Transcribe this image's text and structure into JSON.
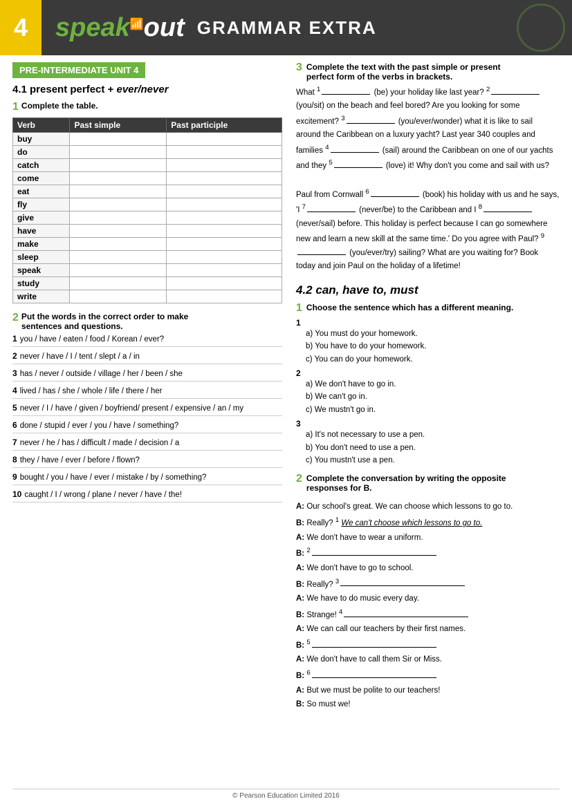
{
  "header": {
    "number": "4",
    "logo_speak": "speak",
    "logo_out": "out",
    "subtitle": "GRAMMAR EXTRA"
  },
  "unit_badge": "PRE-INTERMEDIATE UNIT 4",
  "section_4_1": {
    "title": "4.1 present perfect + ",
    "title_italic": "ever/never",
    "exercise1": {
      "label": "Complete the table.",
      "table": {
        "headers": [
          "Verb",
          "Past simple",
          "Past participle"
        ],
        "rows": [
          [
            "buy",
            "",
            ""
          ],
          [
            "do",
            "",
            ""
          ],
          [
            "catch",
            "",
            ""
          ],
          [
            "come",
            "",
            ""
          ],
          [
            "eat",
            "",
            ""
          ],
          [
            "fly",
            "",
            ""
          ],
          [
            "give",
            "",
            ""
          ],
          [
            "have",
            "",
            ""
          ],
          [
            "make",
            "",
            ""
          ],
          [
            "sleep",
            "",
            ""
          ],
          [
            "speak",
            "",
            ""
          ],
          [
            "study",
            "",
            ""
          ],
          [
            "write",
            "",
            ""
          ]
        ]
      }
    },
    "exercise2": {
      "intro": "Put the words in the correct order to make sentences and questions.",
      "items": [
        {
          "num": "1",
          "text": "you / have / eaten / food / Korean / ever?"
        },
        {
          "num": "2",
          "text": "never / have / I / tent / slept / a / in"
        },
        {
          "num": "3",
          "text": "has / never / outside / village / her / been / she"
        },
        {
          "num": "4",
          "text": "lived / has / she / whole / life / there / her"
        },
        {
          "num": "5",
          "text": "never / I / have / given / boyfriend/ present / expensive / an / my"
        },
        {
          "num": "6",
          "text": "done / stupid / ever / you / have / something?"
        },
        {
          "num": "7",
          "text": "never / he / has / difficult / made / decision / a"
        },
        {
          "num": "8",
          "text": "they / have / ever / before / flown?"
        },
        {
          "num": "9",
          "text": "bought / you / have / ever / mistake / by / something?"
        },
        {
          "num": "10",
          "text": "caught / I / wrong / plane / never / have / the!"
        }
      ]
    }
  },
  "section_3": {
    "intro": "Complete the text with the past simple or present perfect form of the verbs in brackets.",
    "text_parts": [
      {
        "label": "What",
        "super": "1",
        "blank": true,
        "after": "(be) your holiday like last year?"
      },
      {
        "super": "2",
        "blank": true,
        "after": "(you/sit) on the beach and feel bored? Are you looking for some excitement?"
      },
      {
        "super": "3",
        "blank": true,
        "after": "(you/ever/wonder) what it is like to sail around the Caribbean on a luxury yacht? Last year 340 couples and families"
      },
      {
        "super": "4",
        "blank": true,
        "after": "(sail) around the Caribbean on one of our yachts and they"
      },
      {
        "super": "5",
        "blank": true,
        "after": "(love) it! Why don't you come and sail with us?"
      },
      {
        "para": "Paul from Cornwall"
      },
      {
        "super": "6",
        "blank": true,
        "after": "(book) his holiday with us and he says, 'I"
      },
      {
        "super": "7",
        "blank": true,
        "after": "(never/be) to the Caribbean and I"
      },
      {
        "super": "8",
        "blank": true,
        "after": "(never/sail) before. This holiday is perfect because I can go somewhere new and learn a new skill at the same time.' Do you agree with Paul?"
      },
      {
        "super": "9",
        "blank": true,
        "after": "(you/ever/try) sailing? What are you waiting for? Book today and join Paul on the holiday of a lifetime!"
      }
    ]
  },
  "section_4_2": {
    "title": "4.2 can, have to, must",
    "exercise1": {
      "intro": "Choose the sentence which has a different meaning.",
      "items": [
        {
          "num": "1",
          "options": [
            "a) You must do your homework.",
            "b) You have to do your homework.",
            "c) You can do your homework."
          ]
        },
        {
          "num": "2",
          "options": [
            "a) We don't have to go in.",
            "b) We can't go in.",
            "c) We mustn't go in."
          ]
        },
        {
          "num": "3",
          "options": [
            "a) It's not necessary to use a pen.",
            "b) You don't need to use a pen.",
            "c) You mustn't use a pen."
          ]
        }
      ]
    },
    "exercise2": {
      "intro": "Complete the conversation by writing the opposite responses for B.",
      "lines": [
        {
          "speaker": "A",
          "text": "Our school's great. We can choose which lessons to go to."
        },
        {
          "speaker": "B",
          "text": "Really?",
          "num": "1",
          "example": "We can't choose which lessons to go to.",
          "blank": false
        },
        {
          "speaker": "A",
          "text": "We don't have to wear a uniform."
        },
        {
          "speaker": "B",
          "text": "",
          "num": "2",
          "blank": true
        },
        {
          "speaker": "A",
          "text": "We don't have to go to school."
        },
        {
          "speaker": "B",
          "text": "Really?",
          "num": "3",
          "blank": true
        },
        {
          "speaker": "A",
          "text": "We have to do music every day."
        },
        {
          "speaker": "B",
          "text": "Strange!",
          "num": "4",
          "blank": true
        },
        {
          "speaker": "A",
          "text": "We can call our teachers by their first names."
        },
        {
          "speaker": "B",
          "text": "",
          "num": "5",
          "blank": true
        },
        {
          "speaker": "A",
          "text": "We don't have to call them Sir or Miss."
        },
        {
          "speaker": "B",
          "text": "",
          "num": "6",
          "blank": true
        },
        {
          "speaker": "A",
          "text": "But we must be polite to our teachers!"
        },
        {
          "speaker": "B",
          "text": "So must we!"
        }
      ]
    }
  },
  "footer": {
    "text": "© Pearson Education Limited 2016"
  }
}
